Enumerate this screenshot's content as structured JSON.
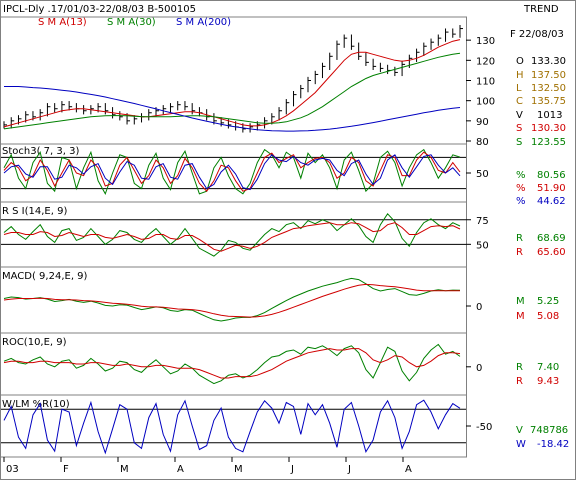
{
  "header": {
    "title": "IPCL-Dly .17/01/03-22/08/03  B-500105",
    "trend": "TREND",
    "sma_labels": [
      {
        "text": "S M A(13)",
        "color": "#d00000"
      },
      {
        "text": "S M A(30)",
        "color": "#008000"
      },
      {
        "text": "S M A(200)",
        "color": "#0000c0"
      }
    ]
  },
  "readout": {
    "date": "F 22/08/03",
    "ohlc": [
      {
        "k": "O",
        "v": "133.30",
        "color": "#000000"
      },
      {
        "k": "H",
        "v": "137.50",
        "color": "#a07000"
      },
      {
        "k": "L",
        "v": "132.50",
        "color": "#a07000"
      },
      {
        "k": "C",
        "v": "135.75",
        "color": "#a07000"
      },
      {
        "k": "V",
        "v": "1013",
        "color": "#000000"
      },
      {
        "k": "S",
        "v": "130.30",
        "color": "#d00000"
      },
      {
        "k": "S",
        "v": "123.55",
        "color": "#008000"
      }
    ],
    "stoch": [
      {
        "k": "%",
        "v": "80.56",
        "color": "#008000"
      },
      {
        "k": "%",
        "v": "51.90",
        "color": "#d00000"
      },
      {
        "k": "%",
        "v": "44.62",
        "color": "#0000c0"
      }
    ],
    "rsi": [
      {
        "k": "R",
        "v": "68.69",
        "color": "#008000"
      },
      {
        "k": "R",
        "v": "65.60",
        "color": "#d00000"
      }
    ],
    "macd": [
      {
        "k": "M",
        "v": "5.25",
        "color": "#008000"
      },
      {
        "k": "M",
        "v": "5.08",
        "color": "#d00000"
      }
    ],
    "roc": [
      {
        "k": "R",
        "v": "7.40",
        "color": "#008000"
      },
      {
        "k": "R",
        "v": "9.43",
        "color": "#d00000"
      }
    ],
    "wlm": [
      {
        "k": "V",
        "v": "748786",
        "color": "#008000"
      },
      {
        "k": "W",
        "v": "-18.42",
        "color": "#0000c0"
      }
    ]
  },
  "chart_data": [
    {
      "type": "line",
      "panel": "price",
      "x_labels": [
        "03",
        "F",
        "M",
        "A",
        "M",
        "J",
        "J",
        "A"
      ],
      "yticks": [
        80,
        90,
        100,
        110,
        120,
        130
      ],
      "ylim": [
        80,
        140
      ],
      "series": [
        {
          "name": "Close",
          "color": "#000000",
          "values": [
            88,
            90,
            91,
            93,
            92,
            94,
            97,
            96,
            98,
            97,
            96,
            95,
            96,
            97,
            95,
            93,
            92,
            90,
            91,
            92,
            94,
            95,
            96,
            97,
            98,
            97,
            95,
            94,
            92,
            90,
            89,
            88,
            87,
            86,
            87,
            88,
            90,
            92,
            95,
            99,
            103,
            106,
            110,
            113,
            117,
            122,
            128,
            131,
            127,
            122,
            119,
            117,
            116,
            115,
            114,
            118,
            121,
            124,
            127,
            129,
            131,
            134,
            133,
            135.75
          ]
        },
        {
          "name": "S M A(13)",
          "color": "#d00000",
          "values": [
            87,
            88,
            89,
            90,
            91,
            92,
            93,
            94,
            95,
            95.5,
            96,
            96,
            95.5,
            95,
            94.5,
            94,
            93.5,
            93,
            92.5,
            92,
            92,
            92.5,
            93,
            93.5,
            94,
            94.5,
            94.5,
            94,
            93,
            92,
            91,
            90,
            89,
            88,
            87.5,
            87.5,
            88,
            89,
            90.5,
            92.5,
            95,
            98,
            101,
            104,
            108,
            112,
            116,
            120,
            123,
            124,
            124,
            123,
            122,
            121,
            120,
            119.5,
            120,
            121,
            122.5,
            124.5,
            126.5,
            128,
            129.5,
            130.3
          ]
        },
        {
          "name": "S M A(30)",
          "color": "#008000",
          "values": [
            86,
            86.5,
            87,
            87.5,
            88,
            88.5,
            89,
            89.5,
            90,
            90.5,
            91,
            91.5,
            92,
            92.3,
            92.5,
            92.6,
            92.6,
            92.5,
            92.3,
            92.1,
            92,
            92,
            92,
            92,
            92.2,
            92.4,
            92.5,
            92.5,
            92.3,
            92,
            91.5,
            91,
            90.5,
            90,
            89.5,
            89,
            88.8,
            88.8,
            89,
            89.5,
            90.5,
            91.5,
            93,
            95,
            97,
            99.5,
            102,
            104.5,
            107,
            109,
            111,
            112.5,
            113.5,
            114.5,
            115.5,
            116.5,
            117.5,
            118.5,
            119.5,
            120.5,
            121.5,
            122.3,
            123,
            123.55
          ]
        },
        {
          "name": "S M A(200)",
          "color": "#0000c0",
          "values": [
            107,
            107,
            107,
            106.8,
            106.5,
            106.3,
            106,
            105.6,
            105.2,
            104.8,
            104.3,
            103.7,
            103.1,
            102.5,
            101.8,
            101,
            100.2,
            99.4,
            98.6,
            97.7,
            96.8,
            95.9,
            95,
            94.1,
            93.2,
            92.3,
            91.4,
            90.6,
            89.8,
            89,
            88.3,
            87.6,
            87,
            86.5,
            86,
            85.6,
            85.3,
            85.1,
            85,
            84.9,
            84.9,
            85,
            85.1,
            85.3,
            85.6,
            85.9,
            86.3,
            86.8,
            87.3,
            87.9,
            88.5,
            89.1,
            89.8,
            90.5,
            91.2,
            91.9,
            92.6,
            93.3,
            94,
            94.6,
            95.2,
            95.7,
            96.2,
            96.6
          ]
        }
      ]
    },
    {
      "type": "line",
      "panel": "stoch",
      "title": "Stoch3( 7, 3, 3)",
      "yticks": [
        50
      ],
      "ylim": [
        0,
        100
      ],
      "hlines": [
        80,
        20
      ],
      "series": [
        {
          "name": "%",
          "color": "#008000",
          "values": [
            60,
            85,
            40,
            20,
            70,
            90,
            30,
            15,
            80,
            75,
            20,
            60,
            90,
            35,
            10,
            50,
            85,
            80,
            30,
            20,
            65,
            88,
            40,
            18,
            70,
            92,
            50,
            10,
            15,
            60,
            80,
            45,
            20,
            10,
            30,
            70,
            95,
            85,
            60,
            90,
            80,
            40,
            88,
            70,
            85,
            60,
            20,
            75,
            90,
            55,
            15,
            30,
            80,
            92,
            70,
            25,
            60,
            85,
            95,
            70,
            40,
            60,
            85,
            80.56
          ]
        },
        {
          "name": "%",
          "color": "#d00000",
          "values": [
            55,
            70,
            60,
            35,
            45,
            75,
            55,
            25,
            50,
            75,
            50,
            45,
            75,
            60,
            25,
            30,
            65,
            80,
            55,
            30,
            45,
            75,
            60,
            30,
            45,
            78,
            60,
            30,
            15,
            35,
            65,
            60,
            35,
            15,
            20,
            50,
            80,
            88,
            70,
            78,
            85,
            60,
            70,
            78,
            80,
            70,
            40,
            50,
            80,
            70,
            35,
            25,
            55,
            85,
            80,
            45,
            45,
            75,
            90,
            80,
            55,
            50,
            70,
            51.9
          ]
        },
        {
          "name": "%",
          "color": "#0000c0",
          "values": [
            50,
            62,
            65,
            48,
            42,
            62,
            62,
            38,
            42,
            65,
            60,
            48,
            62,
            68,
            40,
            28,
            52,
            72,
            65,
            40,
            38,
            62,
            68,
            42,
            38,
            65,
            68,
            42,
            20,
            28,
            52,
            65,
            48,
            22,
            18,
            38,
            68,
            85,
            75,
            72,
            82,
            70,
            65,
            75,
            78,
            75,
            55,
            45,
            68,
            75,
            48,
            28,
            40,
            75,
            85,
            60,
            42,
            62,
            82,
            85,
            65,
            50,
            60,
            44.62
          ]
        }
      ]
    },
    {
      "type": "line",
      "panel": "rsi",
      "title": "R S I(14,E, 9)",
      "yticks": [
        75,
        50
      ],
      "ylim": [
        30,
        90
      ],
      "hlines": [
        75,
        50
      ],
      "series": [
        {
          "name": "R",
          "color": "#008000",
          "values": [
            62,
            68,
            60,
            55,
            63,
            70,
            58,
            52,
            64,
            66,
            54,
            57,
            66,
            58,
            50,
            55,
            64,
            62,
            55,
            52,
            60,
            66,
            58,
            50,
            56,
            66,
            56,
            46,
            42,
            38,
            44,
            54,
            52,
            46,
            44,
            52,
            60,
            66,
            63,
            70,
            72,
            66,
            74,
            71,
            75,
            72,
            64,
            70,
            76,
            69,
            58,
            52,
            70,
            81,
            73,
            56,
            48,
            62,
            72,
            76,
            70,
            66,
            72,
            68.69
          ]
        },
        {
          "name": "R",
          "color": "#d00000",
          "values": [
            60,
            62,
            62,
            60,
            60,
            63,
            62,
            58,
            59,
            62,
            60,
            58,
            60,
            60,
            57,
            56,
            58,
            60,
            58,
            55,
            56,
            60,
            60,
            56,
            55,
            59,
            59,
            55,
            50,
            45,
            43,
            46,
            49,
            48,
            46,
            48,
            52,
            57,
            60,
            63,
            66,
            67,
            69,
            70,
            71,
            72,
            70,
            70,
            72,
            71,
            67,
            63,
            64,
            70,
            72,
            67,
            60,
            60,
            64,
            68,
            69,
            68,
            69,
            65.6
          ]
        }
      ]
    },
    {
      "type": "line",
      "panel": "macd",
      "title": "MACD( 9,24,E, 9)",
      "yticks": [
        0
      ],
      "ylim": [
        -8,
        12
      ],
      "hlines": [],
      "series": [
        {
          "name": "M",
          "color": "#008000",
          "values": [
            2.5,
            3,
            2.8,
            2.3,
            2.5,
            2.8,
            2.3,
            1.5,
            1.8,
            2.2,
            1.6,
            1.2,
            1.6,
            1,
            0.2,
            0,
            0.4,
            0.3,
            -0.5,
            -1.2,
            -0.8,
            -0.3,
            -0.6,
            -1.5,
            -1.8,
            -1.2,
            -1.4,
            -2.5,
            -3.6,
            -4.6,
            -5,
            -4.6,
            -4,
            -3.8,
            -3.8,
            -3.2,
            -2.2,
            -0.8,
            0.5,
            1.8,
            3,
            4,
            5,
            5.8,
            6.6,
            7.2,
            7.8,
            8.6,
            9.2,
            8.8,
            7.4,
            5.8,
            5,
            5.5,
            5.8,
            4.8,
            3.8,
            3.6,
            4.2,
            5,
            5.4,
            5.1,
            5.3,
            5.25
          ]
        },
        {
          "name": "M",
          "color": "#d00000",
          "values": [
            2,
            2.3,
            2.5,
            2.5,
            2.5,
            2.6,
            2.5,
            2.2,
            2.1,
            2.1,
            2,
            1.8,
            1.7,
            1.5,
            1.2,
            0.9,
            0.8,
            0.6,
            0.3,
            -0.1,
            -0.3,
            -0.3,
            -0.4,
            -0.7,
            -1,
            -1.1,
            -1.2,
            -1.5,
            -2,
            -2.6,
            -3.1,
            -3.4,
            -3.5,
            -3.6,
            -3.7,
            -3.6,
            -3.3,
            -2.8,
            -2.1,
            -1.3,
            -0.4,
            0.5,
            1.4,
            2.3,
            3.2,
            4,
            4.8,
            5.6,
            6.3,
            6.9,
            7.2,
            7.1,
            6.8,
            6.6,
            6.4,
            6.1,
            5.7,
            5.3,
            5.1,
            5.1,
            5.1,
            5.1,
            5.1,
            5.08
          ]
        }
      ]
    },
    {
      "type": "line",
      "panel": "roc",
      "title": "ROC(10,E, 9)",
      "yticks": [
        0
      ],
      "ylim": [
        -18,
        22
      ],
      "hlines": [],
      "series": [
        {
          "name": "R",
          "color": "#008000",
          "values": [
            4,
            6,
            3,
            2,
            5,
            7,
            2,
            0,
            4,
            5,
            -1,
            1,
            6,
            2,
            -3,
            -1,
            4,
            3,
            -2,
            -4,
            1,
            5,
            0,
            -5,
            -3,
            2,
            -1,
            -6,
            -9,
            -12,
            -10,
            -6,
            -5,
            -8,
            -6,
            -2,
            3,
            7,
            8,
            11,
            12,
            9,
            14,
            13,
            15,
            12,
            8,
            13,
            15,
            10,
            -2,
            -8,
            3,
            14,
            11,
            -3,
            -10,
            -4,
            6,
            12,
            16,
            9,
            11,
            7.4
          ]
        },
        {
          "name": "R",
          "color": "#d00000",
          "values": [
            3,
            4,
            4,
            3,
            3,
            4,
            4,
            3,
            3,
            3,
            2,
            2,
            3,
            3,
            2,
            1,
            1,
            2,
            1,
            0,
            0,
            1,
            1,
            0,
            -1,
            -1,
            -1,
            -2,
            -4,
            -6,
            -8,
            -8,
            -7,
            -7,
            -7,
            -6,
            -4,
            -2,
            1,
            4,
            6,
            8,
            10,
            11,
            12,
            13,
            12,
            12,
            13,
            13,
            10,
            5,
            3,
            5,
            8,
            7,
            3,
            0,
            1,
            4,
            8,
            10,
            10,
            9.43
          ]
        }
      ]
    },
    {
      "type": "line",
      "panel": "wlm",
      "title": "W/LM %R(10)",
      "yticks": [
        -50
      ],
      "ylim": [
        -100,
        0
      ],
      "hlines": [
        -20,
        -80
      ],
      "series": [
        {
          "name": "W",
          "color": "#0000c0",
          "values": [
            -40,
            -15,
            -70,
            -90,
            -30,
            -10,
            -75,
            -95,
            -20,
            -25,
            -85,
            -45,
            -8,
            -60,
            -98,
            -55,
            -12,
            -20,
            -80,
            -90,
            -35,
            -10,
            -65,
            -95,
            -30,
            -5,
            -50,
            -92,
            -85,
            -40,
            -18,
            -70,
            -90,
            -96,
            -60,
            -25,
            -5,
            -18,
            -45,
            -8,
            -15,
            -65,
            -10,
            -30,
            -12,
            -45,
            -88,
            -20,
            -8,
            -50,
            -96,
            -75,
            -25,
            -5,
            -35,
            -90,
            -60,
            -12,
            -4,
            -25,
            -55,
            -30,
            -10,
            -18.42
          ]
        }
      ]
    }
  ]
}
